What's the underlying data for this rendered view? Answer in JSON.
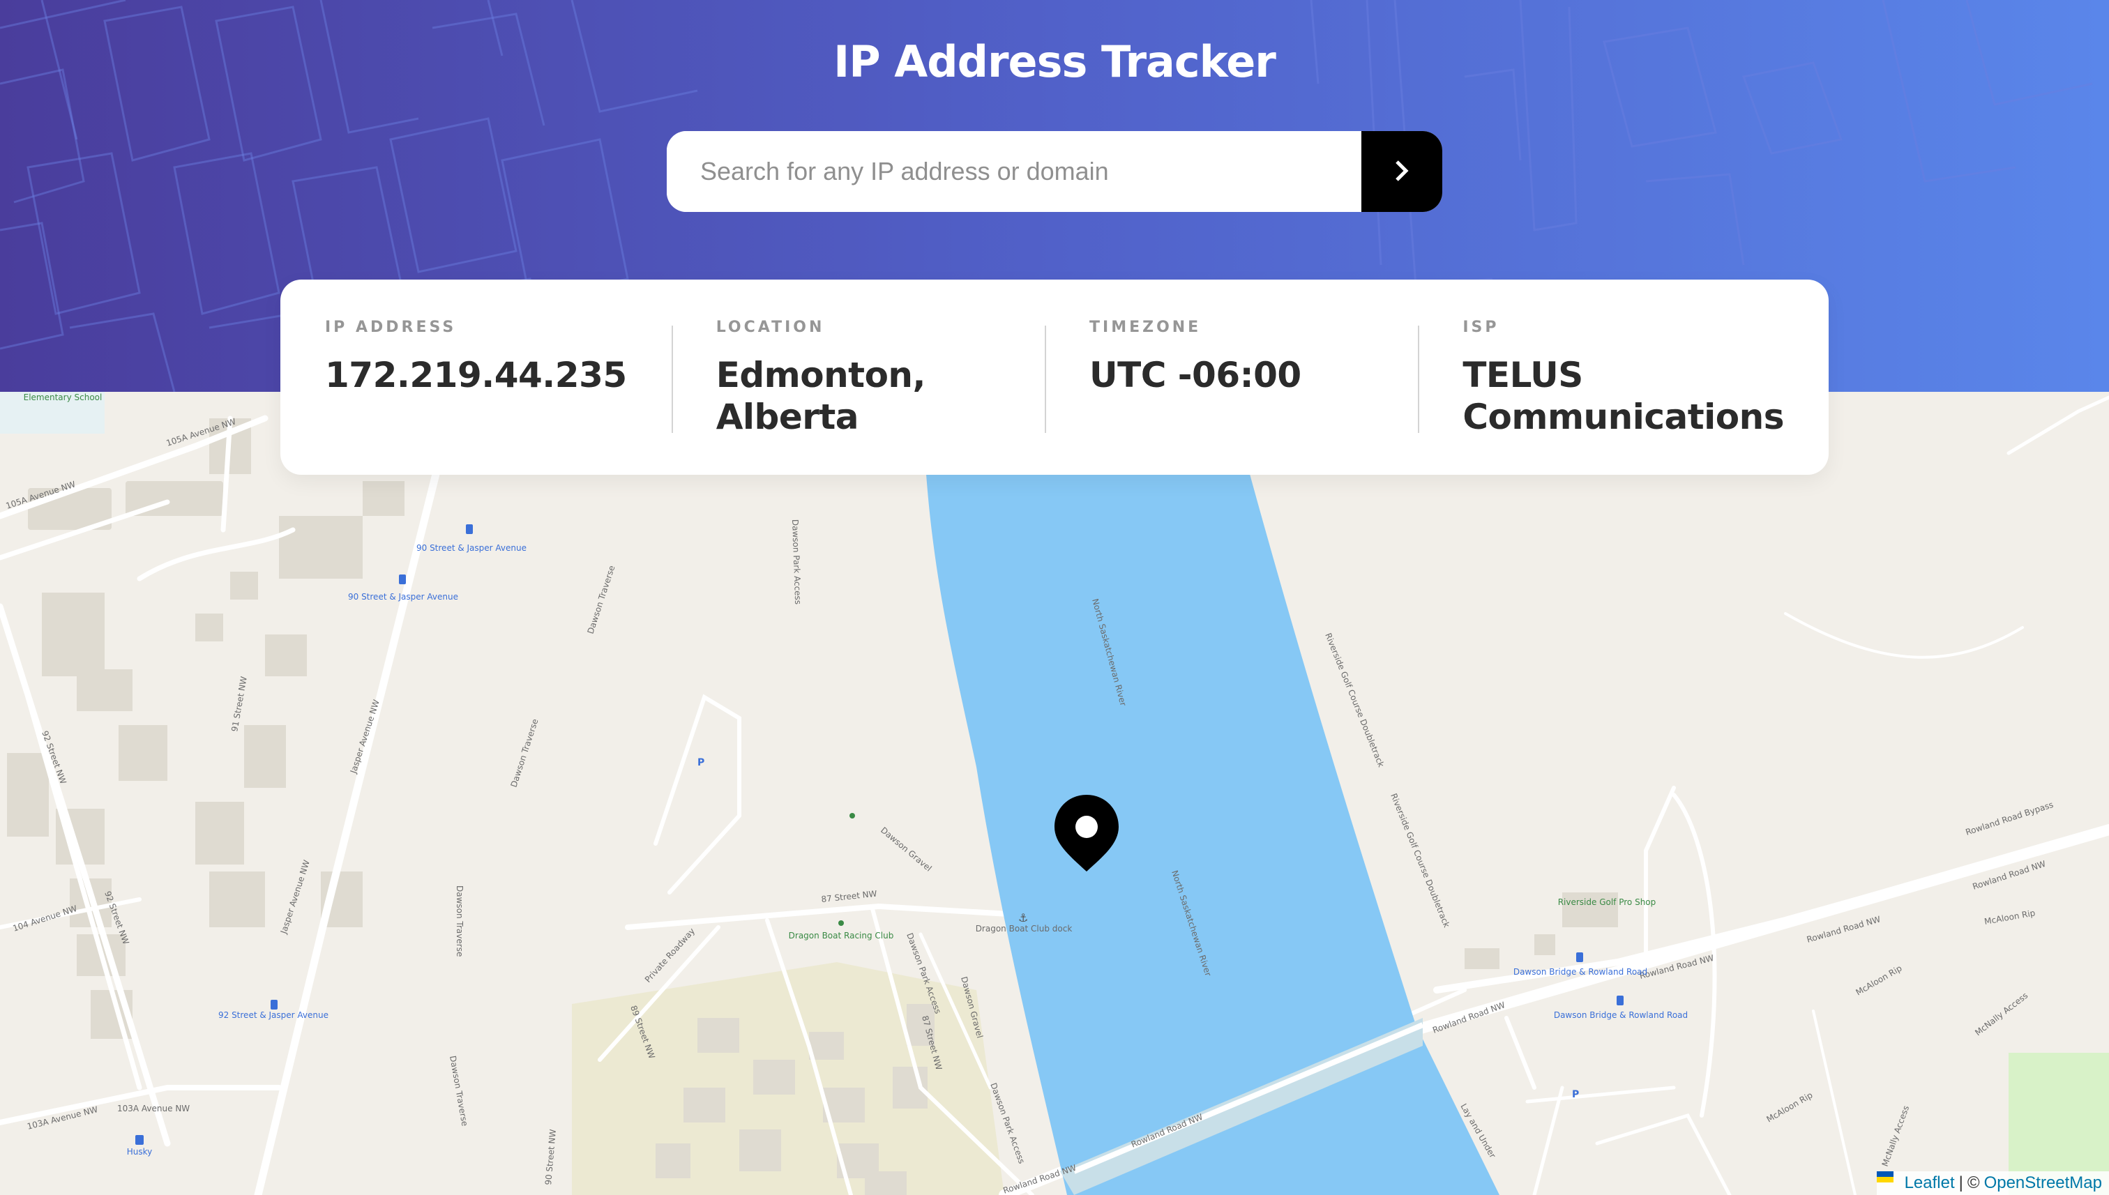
{
  "header": {
    "title": "IP Address Tracker",
    "background_start": "#4a3d9c",
    "background_end": "#5a86ea"
  },
  "search": {
    "placeholder": "Search for any IP address or domain",
    "value": "",
    "submit_icon": "chevron-right-icon"
  },
  "info": {
    "ip_label": "IP ADDRESS",
    "ip_value": "172.219.44.235",
    "location_label": "LOCATION",
    "location_value": "Edmonton, Alberta",
    "timezone_label": "TIMEZONE",
    "timezone_value": "UTC -06:00",
    "isp_label": "ISP",
    "isp_value": "TELUS Communications"
  },
  "map": {
    "river_color": "#86c8f5",
    "land_color": "#f2efe9",
    "labels": {
      "river1": "North Saskatchewan River",
      "river2": "North Saskatchewan River",
      "school": "Elementary School",
      "ave105a": "105A Avenue NW",
      "ave105a_2": "105A Avenue NW",
      "stop_90_jasper_1": "90 Street & Jasper Avenue",
      "stop_90_jasper_2": "90 Street & Jasper Avenue",
      "st91": "91 Street NW",
      "st92": "92 Street NW",
      "st92b": "92 Street NW",
      "ave104a": "104 Avenue NW",
      "jasper1": "Jasper Avenue NW",
      "jasper2": "Jasper Avenue NW",
      "dawson_traverse1": "Dawson Traverse",
      "dawson_traverse2": "Dawson Traverse",
      "dawson_traverse3": "Dawson Traverse",
      "dawson_traverse4": "Dawson Traverse",
      "dawson_park_access1": "Dawson Park Access",
      "dawson_park_access2": "Dawson Park Access",
      "dawson_park_access3": "Dawson Park Access",
      "dawson_gravel1": "Dawson Gravel",
      "dawson_gravel2": "Dawson Gravel",
      "st87": "87 Street NW",
      "st87b": "87 Street NW",
      "private_roadway": "Private Roadway",
      "st89": "89 Street NW",
      "st90": "90 Street NW",
      "stop_92_jasper": "92 Street & Jasper Avenue",
      "ave103a": "103A Avenue NW",
      "ave103a_2": "103A Avenue NW",
      "husky": "Husky",
      "boat_club": "Dragon Boat Racing Club",
      "boat_dock": "Dragon Boat Club dock",
      "riverside_golf1": "Riverside Golf Course Doubletrack",
      "riverside_golf2": "Riverside Golf Course Doubletrack",
      "golf_shop": "Riverside Golf Pro Shop",
      "rowland1": "Rowland Road Bypass",
      "rowland2": "Rowland Road NW",
      "rowland3": "Rowland Road NW",
      "rowland4": "Rowland Road NW",
      "rowland5": "Rowland Road NW",
      "rowland6": "Rowland Road NW",
      "mcaloon1": "McAloon Rip",
      "mcaloon2": "McAloon Rip",
      "mcaloon3": "McAloon Rip",
      "mcnally": "McNally Access",
      "mcnally2": "McNally Access",
      "dawson_bridge1": "Dawson Bridge & Rowland Road",
      "dawson_bridge2": "Dawson Bridge & Rowland Road",
      "lay_under": "Lay and Under",
      "rowland_bottom": "Rowland Road NW"
    }
  },
  "attribution": {
    "leaflet": "Leaflet",
    "separator": "|",
    "copyright": "©",
    "osm": "OpenStreetMap"
  }
}
